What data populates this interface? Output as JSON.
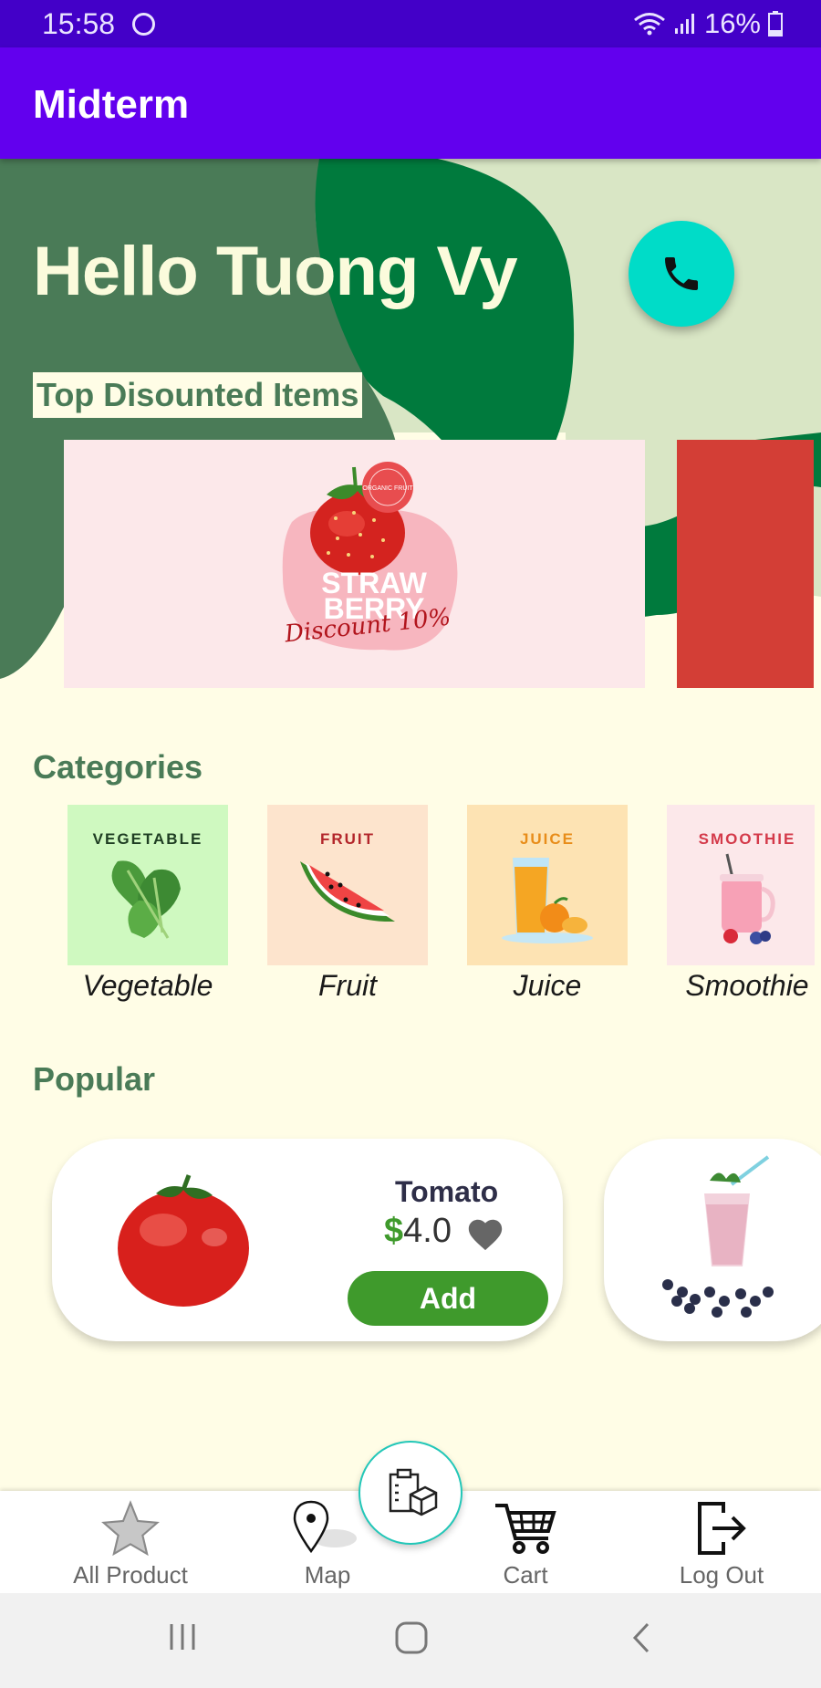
{
  "status_bar": {
    "time": "15:58",
    "battery": "16%"
  },
  "app_bar": {
    "title": "Midterm"
  },
  "hero": {
    "greeting": "Hello Tuong Vy",
    "call_icon": "phone-icon",
    "section_label": "Top Disounted Items"
  },
  "banner": {
    "badge_text": "ORGANIC FRUIT",
    "title_line1": "STRAW",
    "title_line2": "BERRY",
    "discount": "Discount 10%"
  },
  "categories": {
    "title": "Categories",
    "items": [
      {
        "tile_label": "VEGETABLE",
        "name": "Vegetable",
        "tile_color": "#cff9c0",
        "label_color": "#1f3e23"
      },
      {
        "tile_label": "FRUIT",
        "name": "Fruit",
        "tile_color": "#fde4cd",
        "label_color": "#b3262b"
      },
      {
        "tile_label": "JUICE",
        "name": "Juice",
        "tile_color": "#fde3b3",
        "label_color": "#e88d1a"
      },
      {
        "tile_label": "SMOOTHIE",
        "name": "Smoothie",
        "tile_color": "#fce8ea",
        "label_color": "#d43a4a"
      }
    ]
  },
  "popular": {
    "title": "Popular",
    "items": [
      {
        "name": "Tomato",
        "currency": "$",
        "price": "4.0",
        "add_label": "Add"
      }
    ]
  },
  "bottom_nav": {
    "items": [
      {
        "label": "All Product",
        "icon": "star-icon"
      },
      {
        "label": "Map",
        "icon": "map-pin-icon"
      },
      {
        "label": "Cart",
        "icon": "cart-icon"
      },
      {
        "label": "Log Out",
        "icon": "logout-icon"
      }
    ],
    "fab_icon": "order-clipboard-icon"
  },
  "colors": {
    "status_bar": "#4300c8",
    "app_bar": "#6200ee",
    "accent_green": "#3f9a2c",
    "title_green": "#4a7b57",
    "call_button": "#00dcc8",
    "background": "#fffde6"
  }
}
